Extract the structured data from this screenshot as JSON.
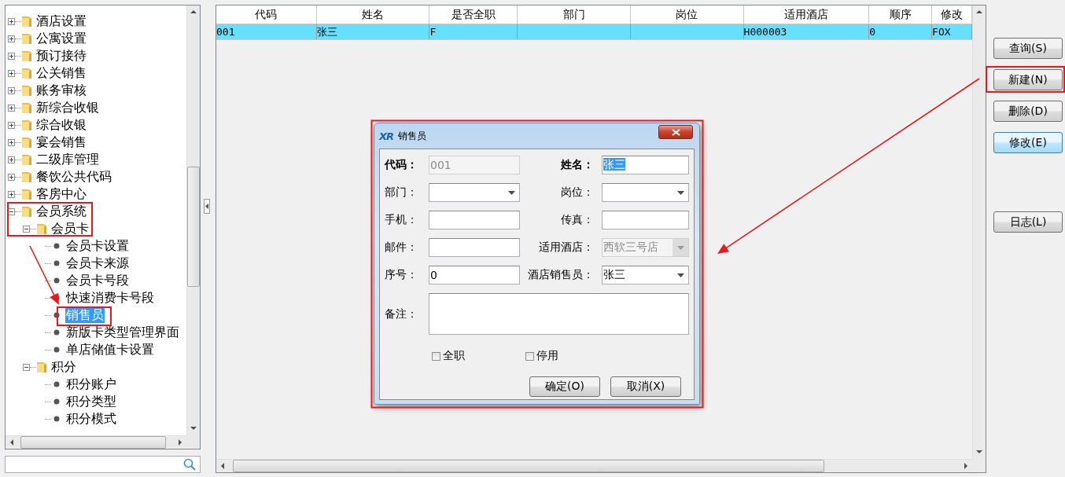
{
  "tree": {
    "items": [
      {
        "label": "酒店设置",
        "kind": "folder",
        "expanded": false,
        "selected": false
      },
      {
        "label": "公寓设置",
        "kind": "folder",
        "expanded": false,
        "selected": false
      },
      {
        "label": "预订接待",
        "kind": "folder",
        "expanded": false,
        "selected": false
      },
      {
        "label": "公关销售",
        "kind": "folder",
        "expanded": false,
        "selected": false
      },
      {
        "label": "账务审核",
        "kind": "folder",
        "expanded": false,
        "selected": false
      },
      {
        "label": "新综合收银",
        "kind": "folder",
        "expanded": false,
        "selected": false
      },
      {
        "label": "综合收银",
        "kind": "folder",
        "expanded": false,
        "selected": false
      },
      {
        "label": "宴会销售",
        "kind": "folder",
        "expanded": false,
        "selected": false
      },
      {
        "label": "二级库管理",
        "kind": "folder",
        "expanded": false,
        "selected": false
      },
      {
        "label": "餐饮公共代码",
        "kind": "folder",
        "expanded": false,
        "selected": false
      },
      {
        "label": "客房中心",
        "kind": "folder",
        "expanded": false,
        "selected": false
      },
      {
        "label": "会员系统",
        "kind": "folder",
        "expanded": true,
        "selected": false,
        "children": [
          {
            "label": "会员卡",
            "kind": "folder",
            "expanded": true,
            "selected": false,
            "children": [
              {
                "label": "会员卡设置",
                "kind": "leaf",
                "selected": false
              },
              {
                "label": "会员卡来源",
                "kind": "leaf",
                "selected": false
              },
              {
                "label": "会员卡号段",
                "kind": "leaf",
                "selected": false
              },
              {
                "label": "快速消费卡号段",
                "kind": "leaf",
                "selected": false
              },
              {
                "label": "销售员",
                "kind": "leaf",
                "selected": true
              },
              {
                "label": "新版卡类型管理界面",
                "kind": "leaf",
                "selected": false
              },
              {
                "label": "单店储值卡设置",
                "kind": "leaf",
                "selected": false
              }
            ]
          },
          {
            "label": "积分",
            "kind": "folder",
            "expanded": true,
            "selected": false,
            "children": [
              {
                "label": "积分账户",
                "kind": "leaf",
                "selected": false
              },
              {
                "label": "积分类型",
                "kind": "leaf",
                "selected": false
              },
              {
                "label": "积分模式",
                "kind": "leaf",
                "selected": false
              }
            ]
          }
        ]
      }
    ]
  },
  "table": {
    "columns": [
      "代码",
      "姓名",
      "是否全职",
      "部门",
      "岗位",
      "适用酒店",
      "顺序",
      "修改"
    ],
    "rows": [
      {
        "selected": true,
        "cells": [
          "001",
          "张三",
          "F",
          "",
          "",
          "H000003",
          "0",
          "FOX"
        ]
      }
    ]
  },
  "actions": [
    {
      "label": "查询(S)",
      "highlighted": false
    },
    {
      "label": "新建(N)",
      "highlighted": false
    },
    {
      "label": "删除(D)",
      "highlighted": false
    },
    {
      "label": "修改(E)",
      "highlighted": true
    },
    {
      "label": "日志(L)",
      "highlighted": false
    }
  ],
  "dialog": {
    "logo": "XR",
    "title": "销售员",
    "fields": [
      {
        "label": "代码：",
        "bold": true,
        "kind": "text",
        "value": "001",
        "disabled": true,
        "value_selected": false
      },
      {
        "label": "姓名：",
        "bold": true,
        "kind": "text",
        "value": "张三",
        "disabled": false,
        "value_selected": true
      },
      {
        "label": "部门：",
        "bold": false,
        "kind": "combo",
        "disabled": false
      },
      {
        "label": "岗位：",
        "bold": false,
        "kind": "combo",
        "disabled": false
      },
      {
        "label": "手机：",
        "bold": false,
        "kind": "text",
        "disabled": false
      },
      {
        "label": "传真：",
        "bold": false,
        "kind": "text",
        "disabled": false
      },
      {
        "label": "邮件：",
        "bold": false,
        "kind": "text",
        "disabled": false
      },
      {
        "label": "适用酒店：",
        "bold": false,
        "kind": "combo",
        "value": "西软三号店",
        "disabled": true
      },
      {
        "label": "序号：",
        "bold": false,
        "kind": "text",
        "value": "0",
        "disabled": false,
        "value_selected": false
      },
      {
        "label": "酒店销售员：",
        "bold": false,
        "kind": "combo",
        "value": "张三",
        "disabled": false
      }
    ],
    "notes_label": "备注：",
    "checkboxes": [
      {
        "label": "全职",
        "checked": false
      },
      {
        "label": "停用",
        "checked": false
      }
    ],
    "buttons": [
      "确定(O)",
      "取消(X)"
    ]
  }
}
